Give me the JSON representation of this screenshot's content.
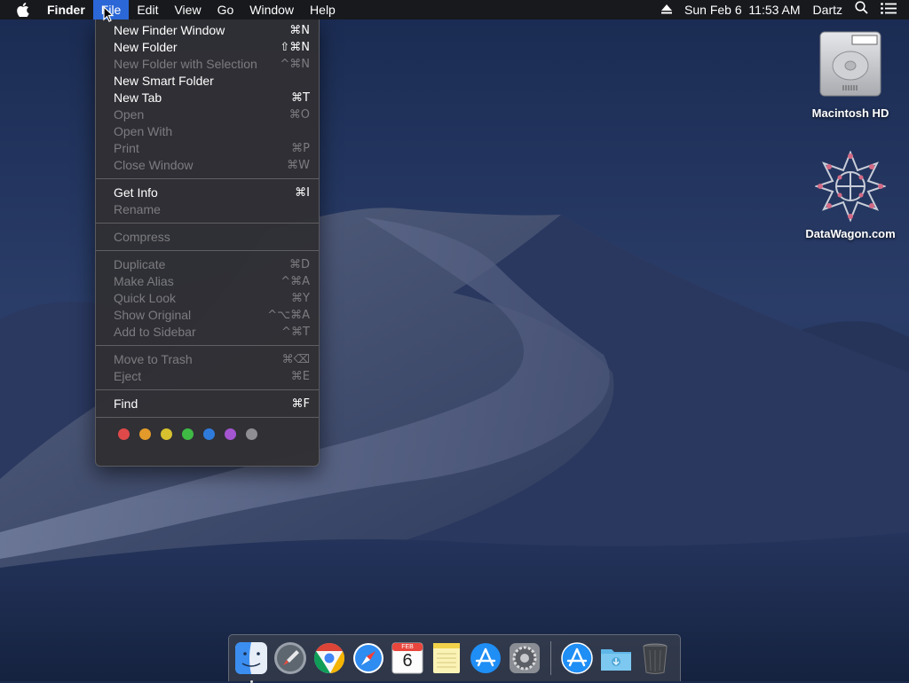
{
  "menubar": {
    "app_name": "Finder",
    "menus": [
      "File",
      "Edit",
      "View",
      "Go",
      "Window",
      "Help"
    ],
    "active_menu": "File",
    "datetime": "Sun Feb 6  11:53 AM",
    "user": "Dartz"
  },
  "file_menu": {
    "groups": [
      [
        {
          "label": "New Finder Window",
          "shortcut": "⌘N",
          "enabled": true
        },
        {
          "label": "New Folder",
          "shortcut": "⇧⌘N",
          "enabled": true
        },
        {
          "label": "New Folder with Selection",
          "shortcut": "^⌘N",
          "enabled": false
        },
        {
          "label": "New Smart Folder",
          "shortcut": "",
          "enabled": true
        },
        {
          "label": "New Tab",
          "shortcut": "⌘T",
          "enabled": true
        },
        {
          "label": "Open",
          "shortcut": "⌘O",
          "enabled": false
        },
        {
          "label": "Open With",
          "shortcut": "",
          "enabled": false
        },
        {
          "label": "Print",
          "shortcut": "⌘P",
          "enabled": false
        },
        {
          "label": "Close Window",
          "shortcut": "⌘W",
          "enabled": false
        }
      ],
      [
        {
          "label": "Get Info",
          "shortcut": "⌘I",
          "enabled": true
        },
        {
          "label": "Rename",
          "shortcut": "",
          "enabled": false
        }
      ],
      [
        {
          "label": "Compress",
          "shortcut": "",
          "enabled": false
        }
      ],
      [
        {
          "label": "Duplicate",
          "shortcut": "⌘D",
          "enabled": false
        },
        {
          "label": "Make Alias",
          "shortcut": "^⌘A",
          "enabled": false
        },
        {
          "label": "Quick Look",
          "shortcut": "⌘Y",
          "enabled": false
        },
        {
          "label": "Show Original",
          "shortcut": "^⌥⌘A",
          "enabled": false
        },
        {
          "label": "Add to Sidebar",
          "shortcut": "^⌘T",
          "enabled": false
        }
      ],
      [
        {
          "label": "Move to Trash",
          "shortcut": "⌘⌫",
          "enabled": false
        },
        {
          "label": "Eject",
          "shortcut": "⌘E",
          "enabled": false
        }
      ],
      [
        {
          "label": "Find",
          "shortcut": "⌘F",
          "enabled": true
        }
      ]
    ],
    "tag_colors": [
      "#e0494a",
      "#e39a2a",
      "#d8c12e",
      "#3fba45",
      "#2f7bdc",
      "#a455d0",
      "#8e8e93"
    ]
  },
  "desktop_icons": [
    {
      "label": "Macintosh HD",
      "icon": "hard-drive-icon"
    },
    {
      "label": "DataWagon.com",
      "icon": "datawagon-logo-icon"
    }
  ],
  "dock": {
    "calendar": {
      "month": "FEB",
      "day": "6"
    },
    "apps": [
      {
        "name": "finder",
        "icon": "finder-icon",
        "running": true
      },
      {
        "name": "launchpad",
        "icon": "launchpad-icon",
        "running": false
      },
      {
        "name": "chrome",
        "icon": "chrome-icon",
        "running": false
      },
      {
        "name": "safari",
        "icon": "safari-icon",
        "running": false
      },
      {
        "name": "calendar",
        "icon": "calendar-icon",
        "running": false
      },
      {
        "name": "notes",
        "icon": "notes-icon",
        "running": false
      },
      {
        "name": "app-store",
        "icon": "app-store-icon",
        "running": false
      },
      {
        "name": "system-preferences",
        "icon": "system-preferences-icon",
        "running": false
      },
      {
        "name": "app-store-downloads",
        "icon": "app-store-icon",
        "running": false
      },
      {
        "name": "downloads-folder",
        "icon": "downloads-folder-icon",
        "running": false
      },
      {
        "name": "trash",
        "icon": "trash-icon",
        "running": false
      }
    ]
  }
}
